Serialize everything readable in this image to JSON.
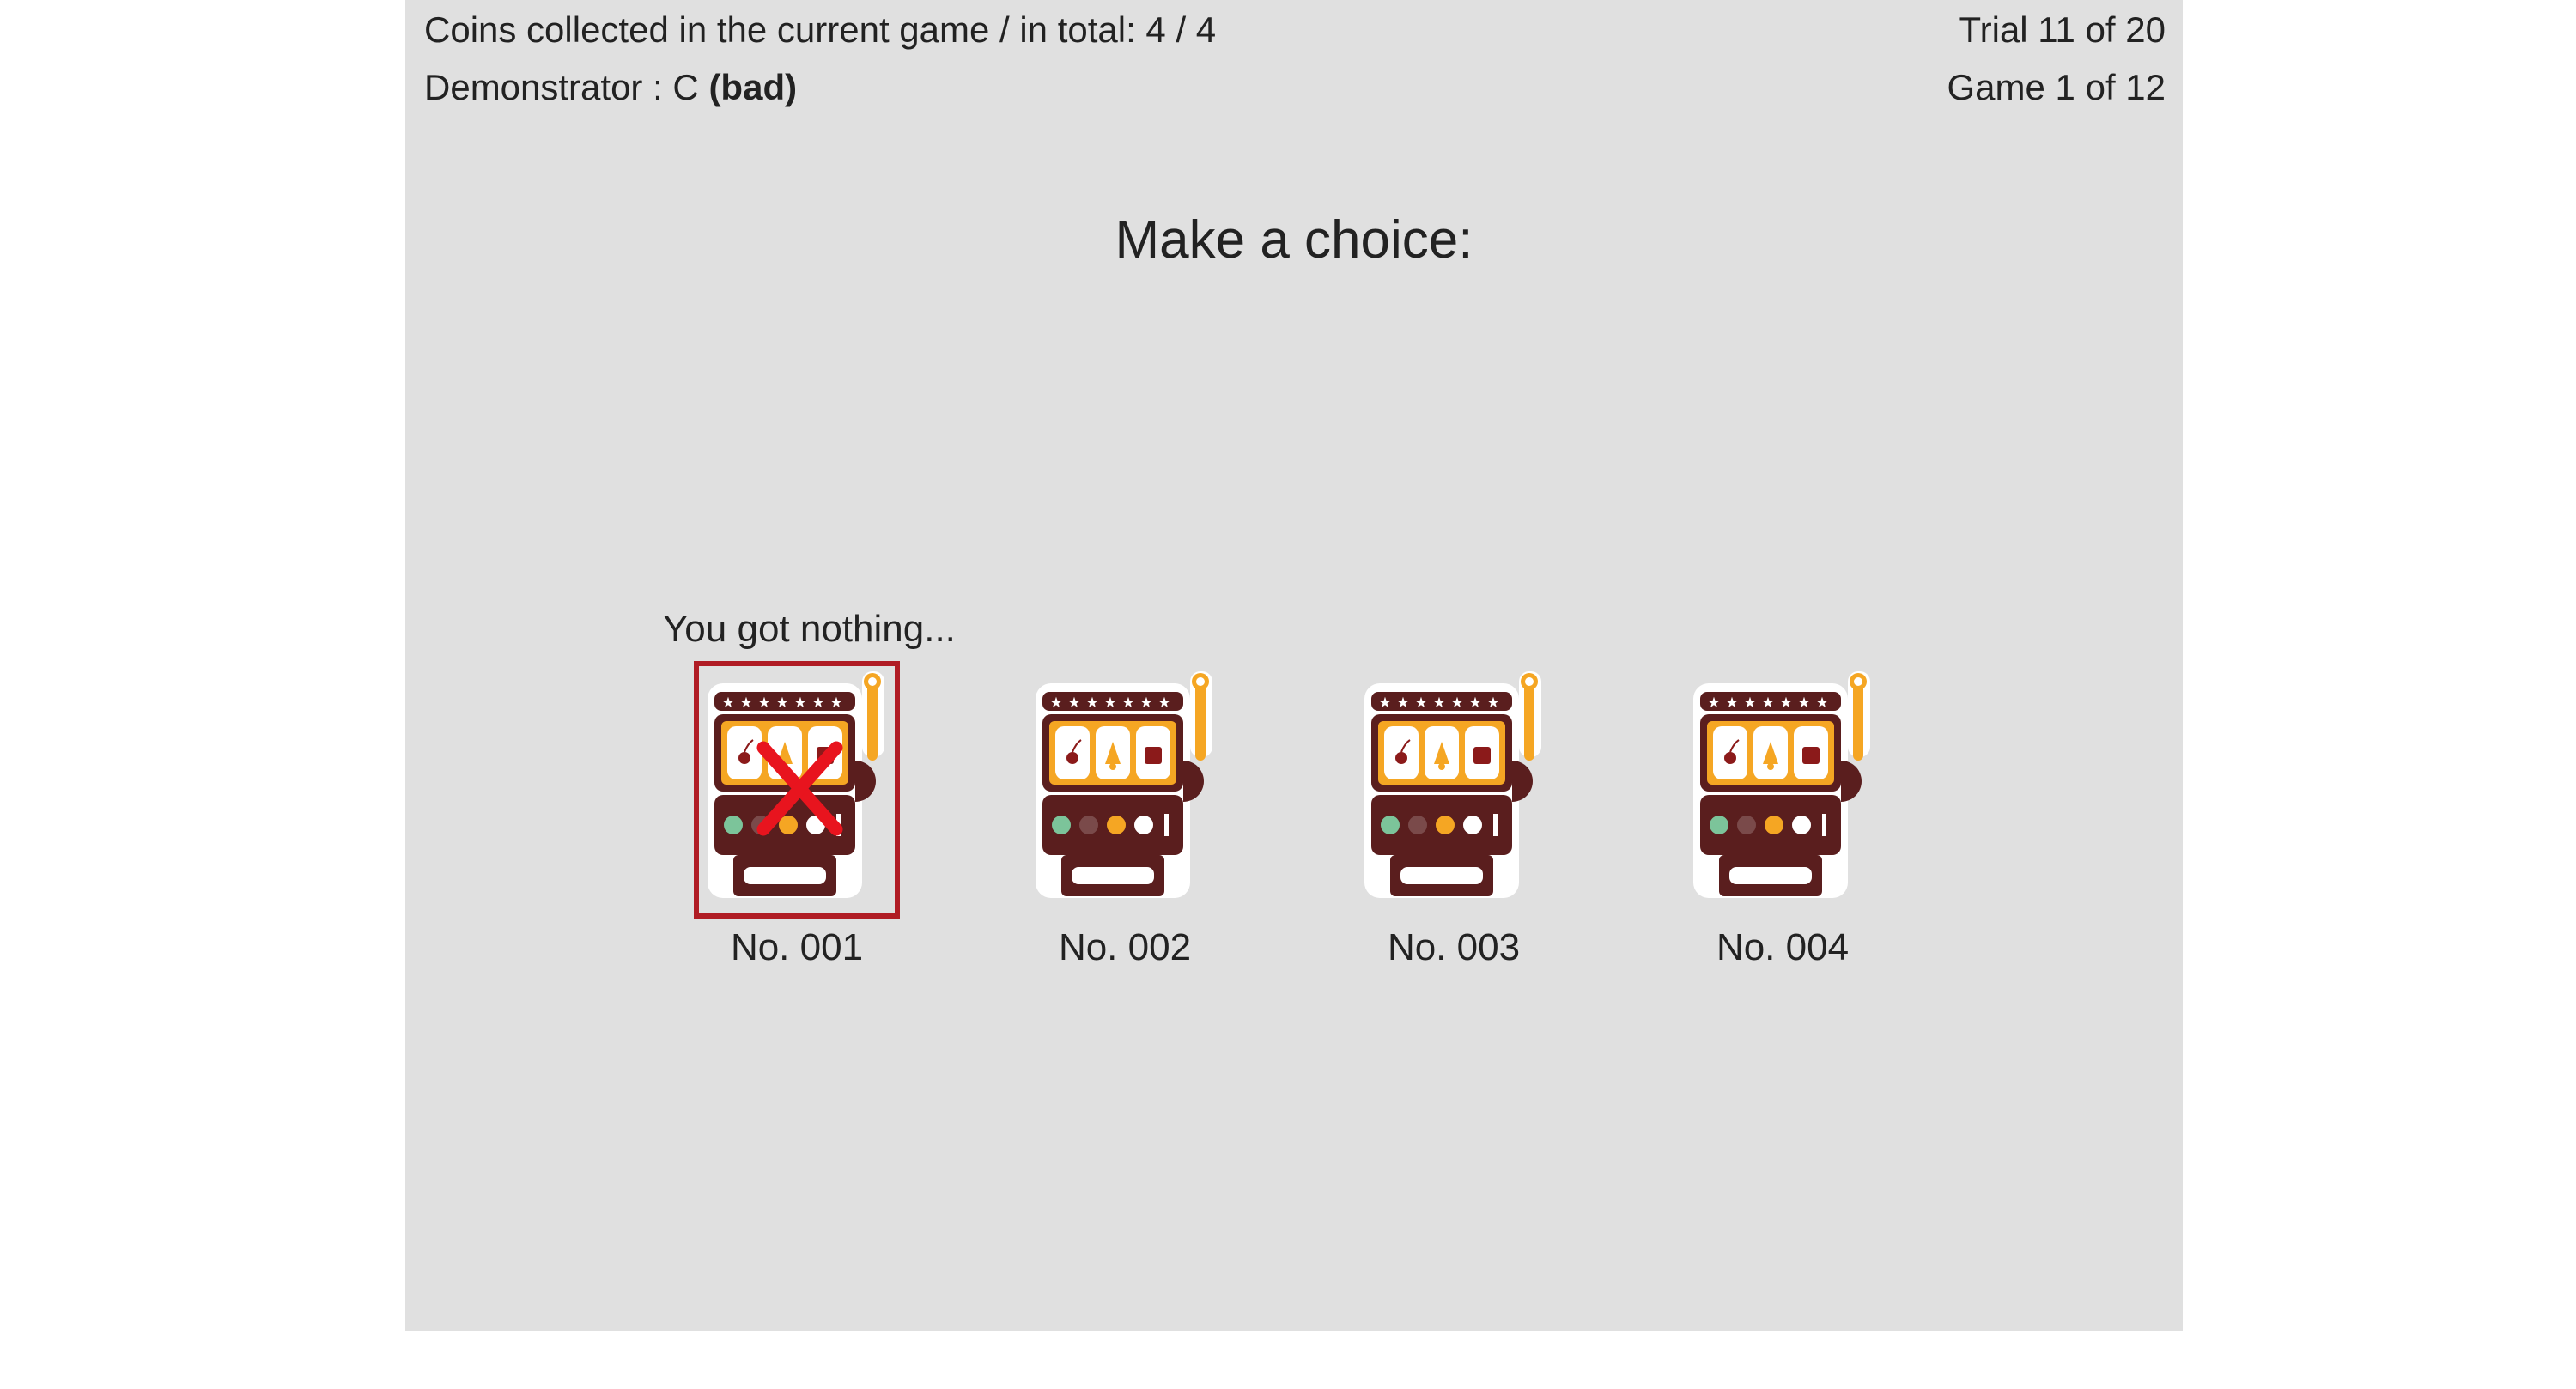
{
  "status": {
    "coins_text": "Coins collected in the current game / in total: 4 / 4",
    "demonstrator_prefix": "Demonstrator : C ",
    "demonstrator_quality": "(bad)",
    "trial_text": "Trial 11 of 20",
    "game_text": "Game 1 of 12"
  },
  "prompt": "Make a choice:",
  "feedback": "You got nothing...",
  "machines": [
    {
      "label": "No. 001",
      "selected": true,
      "outcome": "nothing",
      "icon": "slot-machine-icon"
    },
    {
      "label": "No. 002",
      "selected": false,
      "icon": "slot-machine-icon"
    },
    {
      "label": "No. 003",
      "selected": false,
      "icon": "slot-machine-icon"
    },
    {
      "label": "No. 004",
      "selected": false,
      "icon": "slot-machine-icon"
    }
  ],
  "colors": {
    "panel_bg": "#e0e0e0",
    "selection_border": "#b01c24",
    "cross": "#e8141e",
    "machine_body": "#5a1e1e",
    "machine_accent": "#f5a623"
  }
}
